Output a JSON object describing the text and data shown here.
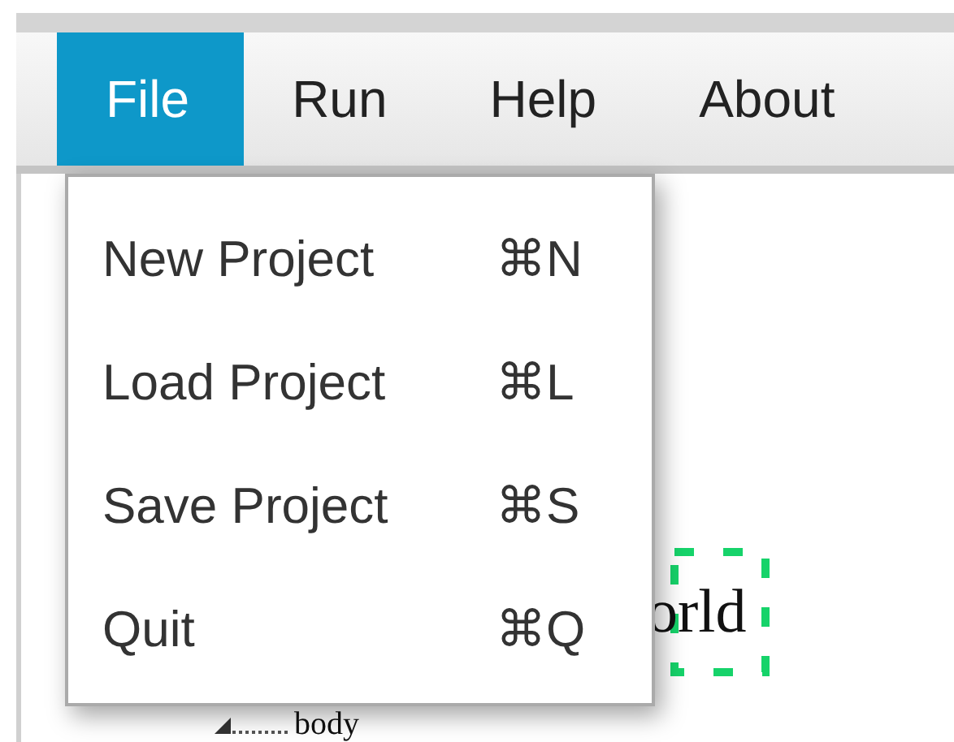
{
  "menubar": [
    {
      "label": "File",
      "selected": true
    },
    {
      "label": "Run",
      "selected": false
    },
    {
      "label": "Help",
      "selected": false
    },
    {
      "label": "About",
      "selected": false
    }
  ],
  "file_menu": [
    {
      "label": "New Project",
      "shortcut": "⌘N"
    },
    {
      "label": "Load Project",
      "shortcut": "⌘L"
    },
    {
      "label": "Save Project",
      "shortcut": "⌘S"
    },
    {
      "label": "Quit",
      "shortcut": "⌘Q"
    }
  ],
  "canvas": {
    "node_text": "orld",
    "label_text": "body"
  }
}
